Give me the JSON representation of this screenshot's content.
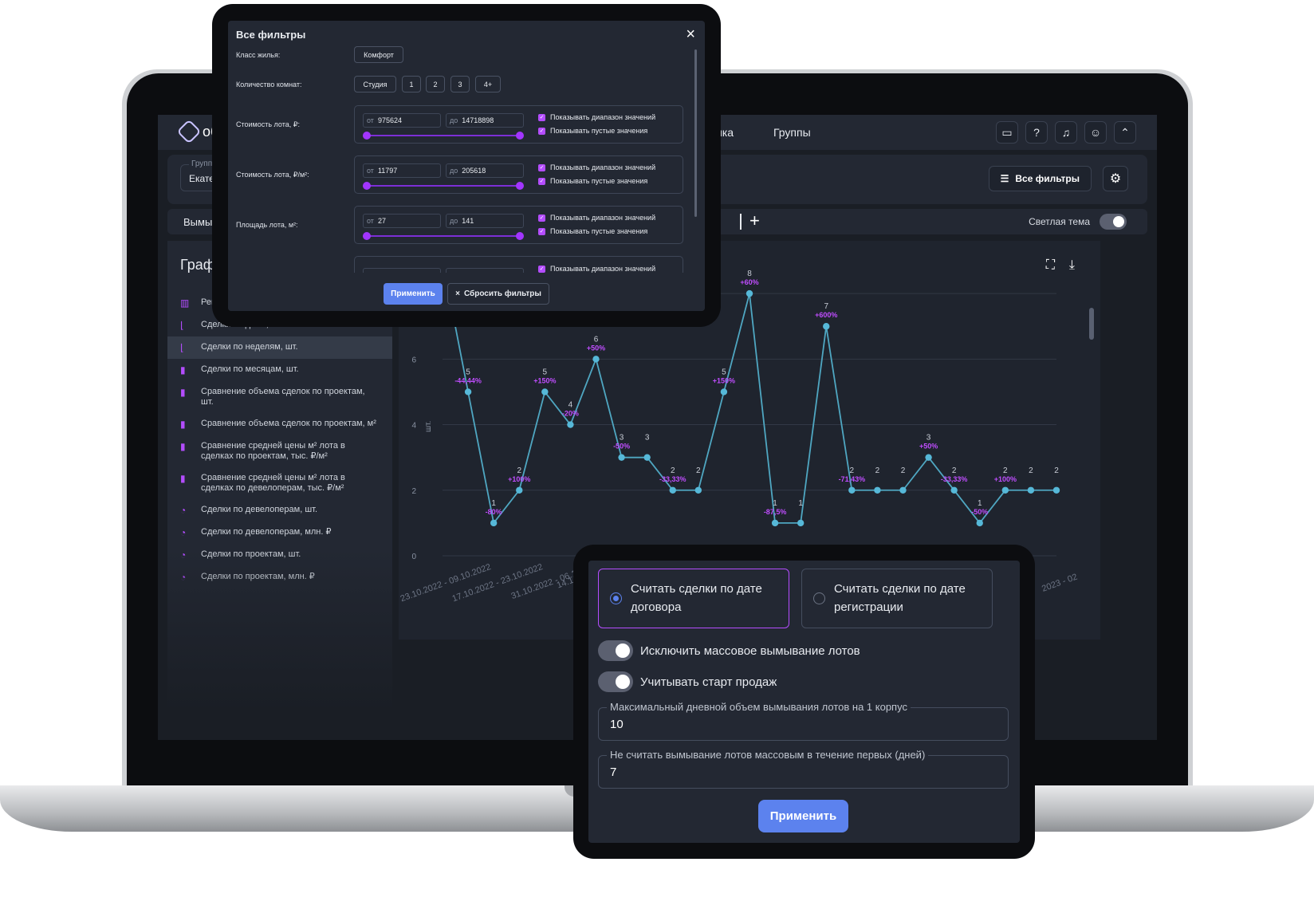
{
  "app": {
    "logo_text": "об",
    "nav": [
      "ынка",
      "Группы"
    ],
    "top_icons": [
      "card-icon",
      "help-icon",
      "bell-icon",
      "user-icon",
      "chevron-up-icon"
    ]
  },
  "group": {
    "legend": "Группа",
    "value": "Екатери"
  },
  "toolbar": {
    "all_filters": "Все фильтры",
    "settings_icon": "gear-icon"
  },
  "tabs": {
    "first": "Вымыва",
    "add": "+"
  },
  "theme": {
    "label": "Светлая тема",
    "enabled": true
  },
  "sidebar": {
    "title": "Графи",
    "items": [
      {
        "label": "Рейт",
        "icon": "columns-icon"
      },
      {
        "label": "Сделки по дням, шт.",
        "icon": "line-axis-icon"
      },
      {
        "label": "Сделки по неделям, шт.",
        "icon": "line-axis-icon",
        "active": true
      },
      {
        "label": "Сделки по месяцам, шт.",
        "icon": "bar-chart-icon"
      },
      {
        "label": "Сравнение объема сделок по проектам, шт.",
        "icon": "bar-chart-icon"
      },
      {
        "label": "Сравнение объема сделок по проектам, м²",
        "icon": "bar-chart-icon"
      },
      {
        "label": "Сравнение средней цены м² лота в сделках по проектам, тыс. ₽/м²",
        "icon": "bar-chart-icon"
      },
      {
        "label": "Сравнение средней цены м² лота в сделках по девелоперам, тыс. ₽/м²",
        "icon": "bar-chart-icon"
      },
      {
        "label": "Сделки по девелоперам, шт.",
        "icon": "pie-chart-icon"
      },
      {
        "label": "Сделки по девелоперам, млн. ₽",
        "icon": "pie-chart-icon"
      },
      {
        "label": "Сделки по проектам, шт.",
        "icon": "pie-chart-icon"
      },
      {
        "label": "Сделки по проектам, млн. ₽",
        "icon": "pie-chart-icon"
      }
    ]
  },
  "chart_icons": [
    "fullscreen-icon",
    "download-icon"
  ],
  "chart_data": {
    "type": "line",
    "ylabel": "шт.",
    "ylim": [
      0,
      9
    ],
    "yticks": [
      0,
      2,
      4,
      6,
      8
    ],
    "grid": true,
    "x_labels": [
      "23.10.2022 - 09.10.2022",
      "17.10.2022 - 23.10.2022",
      "31.10.2022 - 06.11.2",
      "14.1",
      "2023",
      "2023 - 02"
    ],
    "values": [
      9,
      5,
      1,
      2,
      5,
      4,
      6,
      3,
      3,
      2,
      2,
      5,
      8,
      1,
      1,
      7,
      2,
      2,
      2,
      3,
      2,
      1,
      2,
      2,
      2
    ],
    "value_labels": [
      "",
      "5",
      "1",
      "2",
      "5",
      "4",
      "6",
      "3",
      "3",
      "2",
      "2",
      "5",
      "8",
      "1",
      "1",
      "7",
      "2",
      "2",
      "2",
      "3",
      "2",
      "1",
      "2",
      "2",
      "2"
    ],
    "change_labels": [
      "",
      "-44,44%",
      "-80%",
      "+100%",
      "+150%",
      "-20%",
      "+50%",
      "-50%",
      "",
      "-33,33%",
      "",
      "+150%",
      "+60%",
      "-87,5%",
      "",
      "+600%",
      "-71,43%",
      "",
      "",
      "+50%",
      "-33,33%",
      "-50%",
      "+100%",
      "",
      ""
    ],
    "colors": {
      "line": "#4fa7c2",
      "point": "#56b8d8",
      "change": "#c04dff",
      "value": "#c9ced7",
      "grid": "#323846"
    }
  },
  "filter_modal": {
    "title": "Все фильтры",
    "close_icon": "close-icon",
    "housing_class": {
      "label": "Класс жилья:",
      "options": [
        "Комфорт"
      ]
    },
    "rooms": {
      "label": "Количество комнат:",
      "options": [
        "Студия",
        "1",
        "2",
        "3",
        "4+"
      ]
    },
    "ranges": [
      {
        "label": "Стоимость лота, ₽:",
        "from_prefix": "от",
        "from": "975624",
        "to_prefix": "до",
        "to": "14718898",
        "show_range": "Показывать диапазон значений",
        "show_empty": "Показывать пустые значения"
      },
      {
        "label": "Стоимость лота, ₽/м²:",
        "from_prefix": "от",
        "from": "11797",
        "to_prefix": "до",
        "to": "205618",
        "show_range": "Показывать диапазон значений",
        "show_empty": "Показывать пустые значения"
      },
      {
        "label": "Площадь лота, м²:",
        "from_prefix": "от",
        "from": "27",
        "to_prefix": "до",
        "to": "141",
        "show_range": "Показывать диапазон значений",
        "show_empty": "Показывать пустые значения"
      }
    ],
    "partial_range_check": "Показывать диапазон значений",
    "apply": "Применить",
    "reset": "Сбросить фильтры"
  },
  "settings_modal": {
    "radio_contract": "Считать сделки по дате договора",
    "radio_registration": "Считать сделки по дате регистрации",
    "selected": "contract",
    "toggle_exclude": {
      "label": "Исключить массовое вымывание лотов",
      "on": true
    },
    "toggle_start": {
      "label": "Учитывать старт продаж",
      "on": true
    },
    "max_daily": {
      "legend": "Максимальный дневной объем вымывания лотов на 1 корпус",
      "value": "10"
    },
    "first_days": {
      "legend": "Не считать вымывание лотов массовым в течение первых (дней)",
      "value": "7"
    },
    "apply": "Применить"
  }
}
